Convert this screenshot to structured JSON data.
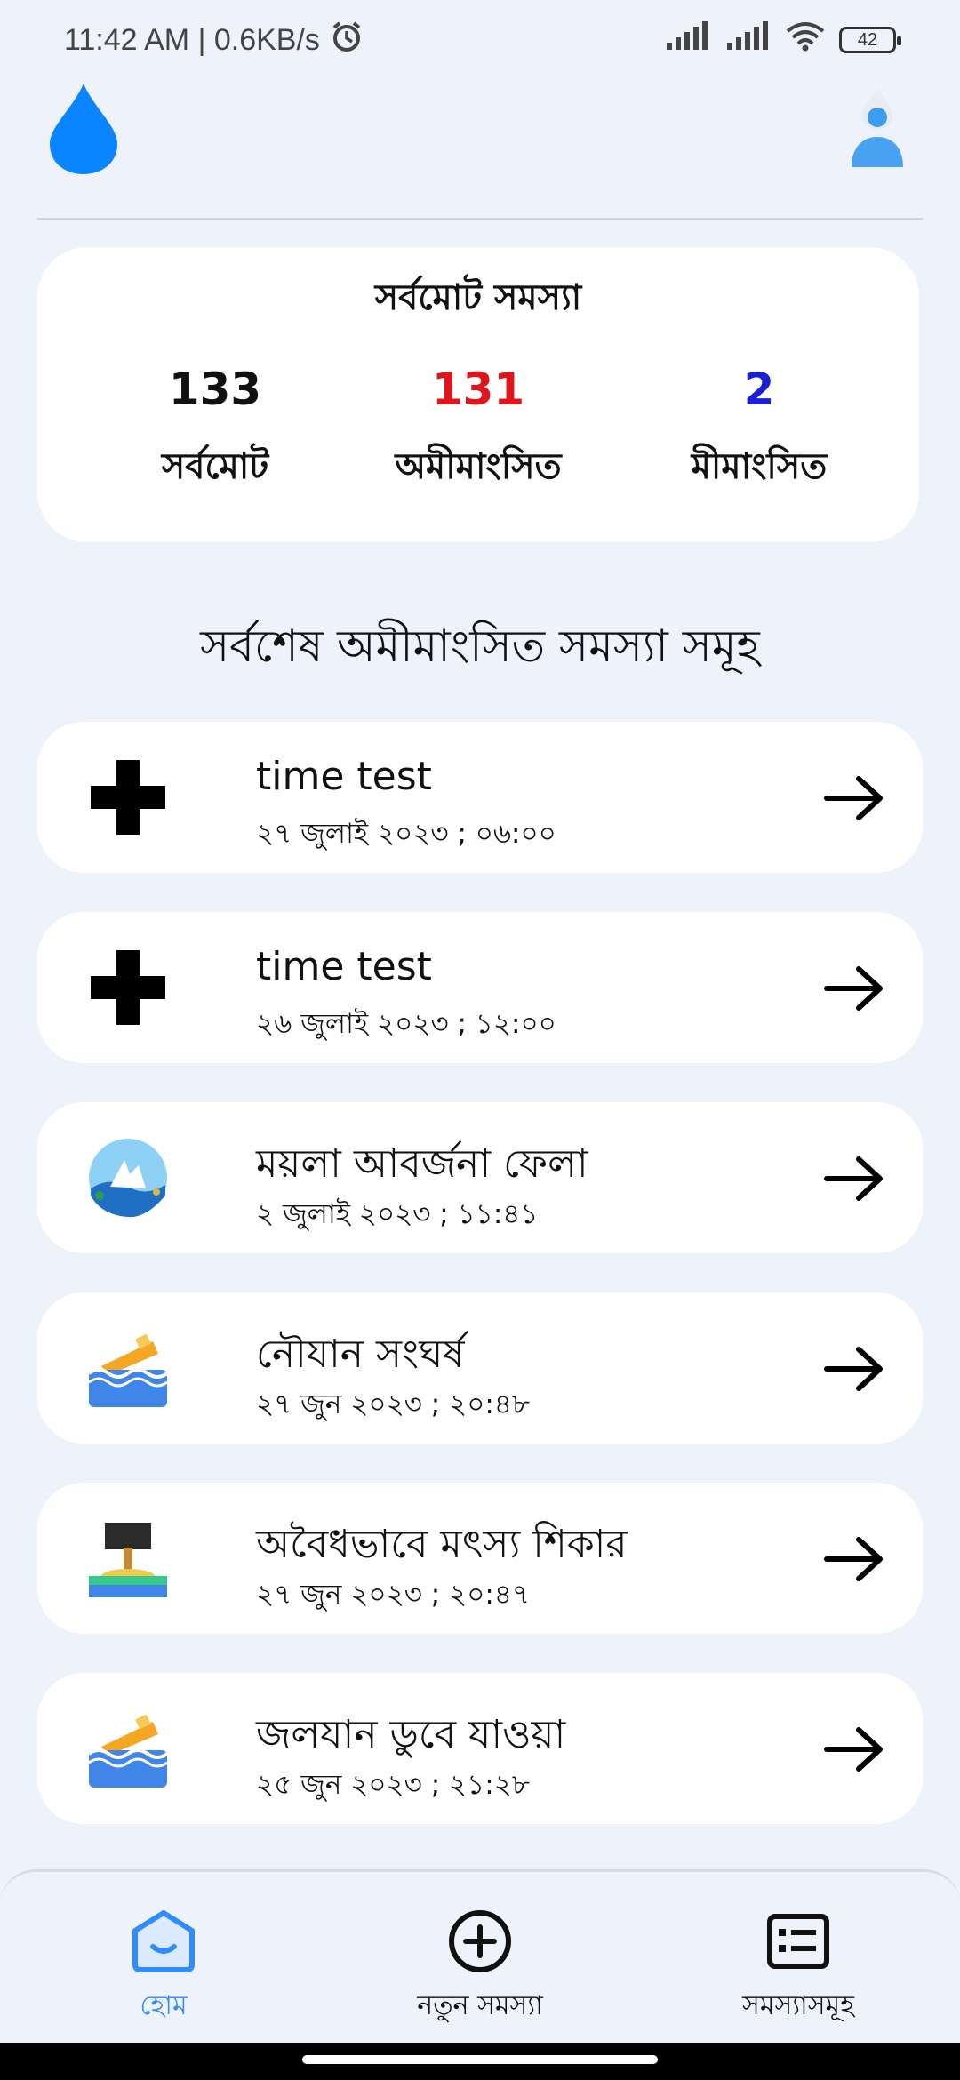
{
  "status_bar": {
    "time_speed": "11:42 AM | 0.6KB/s",
    "battery": "42"
  },
  "icons": {
    "app_logo": "water-drop-icon",
    "profile": "user-avatar-icon",
    "alarm": "alarm-clock-icon"
  },
  "summary": {
    "title": "সর্বমোট সমস্যা",
    "total": {
      "value": "133",
      "label": "সর্বমোট",
      "color": "#111111"
    },
    "unresolved": {
      "value": "131",
      "label": "অমীমাংসিত",
      "color": "#e0151b"
    },
    "resolved": {
      "value": "2",
      "label": "মীমাংসিত",
      "color": "#1a1fd6"
    }
  },
  "section_title": "সর্বশেষ অমীমাংসিত সমস্যা সমূহ",
  "issues": [
    {
      "title": "time test",
      "date": "২৭ জুলাই ২০২৩ ; ০৬:০০",
      "icon": "plus-icon"
    },
    {
      "title": "time test",
      "date": "২৬ জুলাই ২০২৩ ; ১২:০০",
      "icon": "plus-icon"
    },
    {
      "title": "ময়লা আবর্জনা ফেলা",
      "date": "২ জুলাই ২০২৩ ; ১১:৪১",
      "icon": "waste-dumping-icon"
    },
    {
      "title": "নৌযান সংঘর্ষ",
      "date": "২৭ জুন ২০২৩ ; ২০:৪৮",
      "icon": "boat-collision-icon"
    },
    {
      "title": "অবৈধভাবে মৎস্য শিকার",
      "date": "২৭ জুন ২০২৩ ; ২০:৪৭",
      "icon": "illegal-fishing-icon"
    },
    {
      "title": "জলযান ডুবে যাওয়া",
      "date": "২৫ জুন ২০২৩ ; ২১:২৮",
      "icon": "sinking-boat-icon"
    }
  ],
  "bottom_nav": {
    "home": "হোম",
    "new_issue": "নতুন সমস্যা",
    "issues": "সমস্যাসমূহ",
    "active_color": "#2f8bff"
  }
}
